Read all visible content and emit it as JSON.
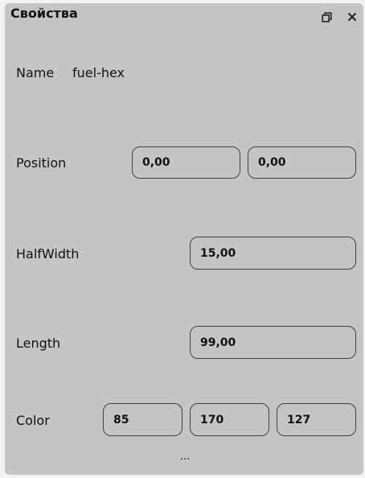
{
  "panel": {
    "title": "Свойства",
    "restore_icon": "restore-window-icon",
    "close_icon": "close-icon"
  },
  "properties": {
    "name": {
      "label": "Name",
      "value": "fuel-hex"
    },
    "position": {
      "label": "Position",
      "x": "0,00",
      "y": "0,00"
    },
    "half_width": {
      "label": "HalfWidth",
      "value": "15,00"
    },
    "length": {
      "label": "Length",
      "value": "99,00"
    },
    "color": {
      "label": "Color",
      "r": "85",
      "g": "170",
      "b": "127"
    }
  },
  "more_indicator": "..."
}
